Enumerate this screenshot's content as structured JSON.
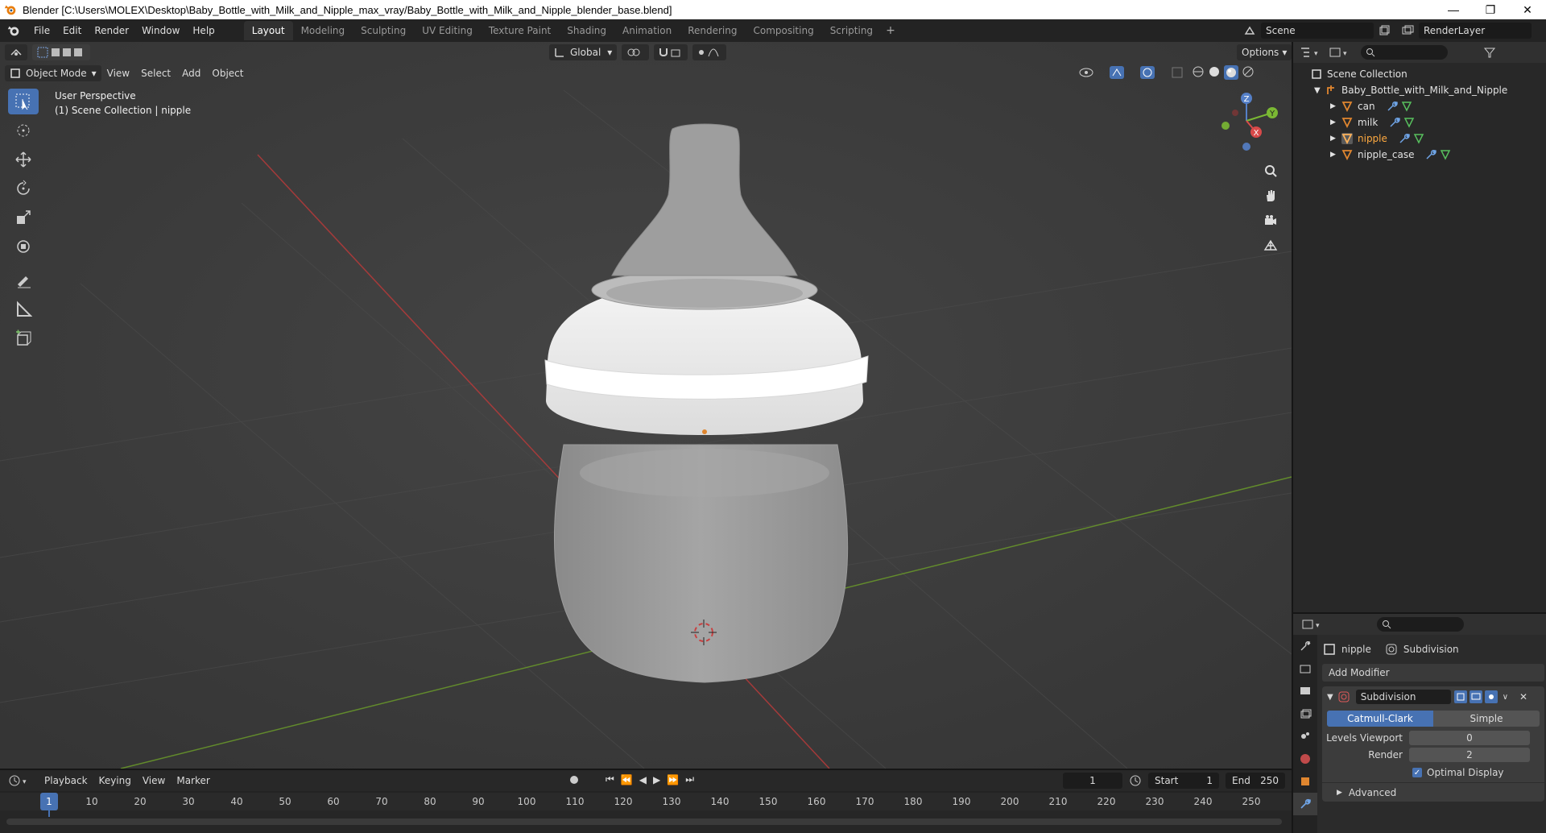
{
  "window": {
    "title": "Blender [C:\\Users\\MOLEX\\Desktop\\Baby_Bottle_with_Milk_and_Nipple_max_vray/Baby_Bottle_with_Milk_and_Nipple_blender_base.blend]"
  },
  "topbar": {
    "menus": [
      "File",
      "Edit",
      "Render",
      "Window",
      "Help"
    ],
    "workspace_tabs": [
      "Layout",
      "Modeling",
      "Sculpting",
      "UV Editing",
      "Texture Paint",
      "Shading",
      "Animation",
      "Rendering",
      "Compositing",
      "Scripting"
    ],
    "active_tab": "Layout",
    "add_tab": "+",
    "scene": "Scene",
    "render_layer": "RenderLayer"
  },
  "viewport": {
    "mode": "Object Mode",
    "menus": [
      "View",
      "Select",
      "Add",
      "Object"
    ],
    "orientation": "Global",
    "options_label": "Options",
    "overlay_line1": "User Perspective",
    "overlay_line2": "(1) Scene Collection | nipple",
    "gizmo": {
      "z": "Z",
      "y": "Y",
      "x": "X"
    }
  },
  "outliner": {
    "root": "Scene Collection",
    "collection": "Baby_Bottle_with_Milk_and_Nipple",
    "objects": [
      "can",
      "milk",
      "nipple",
      "nipple_case"
    ],
    "active_object": "nipple"
  },
  "properties": {
    "object_name": "nipple",
    "modifier_breadcrumb": "Subdivision",
    "add_modifier": "Add Modifier",
    "modifier_name": "Subdivision",
    "subdiv_types": [
      "Catmull-Clark",
      "Simple"
    ],
    "active_type": "Catmull-Clark",
    "levels_viewport_label": "Levels Viewport",
    "levels_viewport": "0",
    "render_label": "Render",
    "render_value": "2",
    "optimal_display": "Optimal Display",
    "optimal_display_checked": true,
    "advanced": "Advanced"
  },
  "timeline": {
    "menus": [
      "Playback",
      "Keying",
      "View",
      "Marker"
    ],
    "current_frame": "1",
    "start_label": "Start",
    "start": "1",
    "end_label": "End",
    "end": "250",
    "ruler": [
      "1",
      "10",
      "20",
      "30",
      "40",
      "50",
      "60",
      "70",
      "80",
      "90",
      "100",
      "110",
      "120",
      "130",
      "140",
      "150",
      "160",
      "170",
      "180",
      "190",
      "200",
      "210",
      "220",
      "230",
      "240",
      "250"
    ]
  },
  "colors": {
    "accent": "#4772b3",
    "x_axis": "#b83a3a",
    "y_axis": "#6a9a2a",
    "object_orange": "#e0862f"
  }
}
